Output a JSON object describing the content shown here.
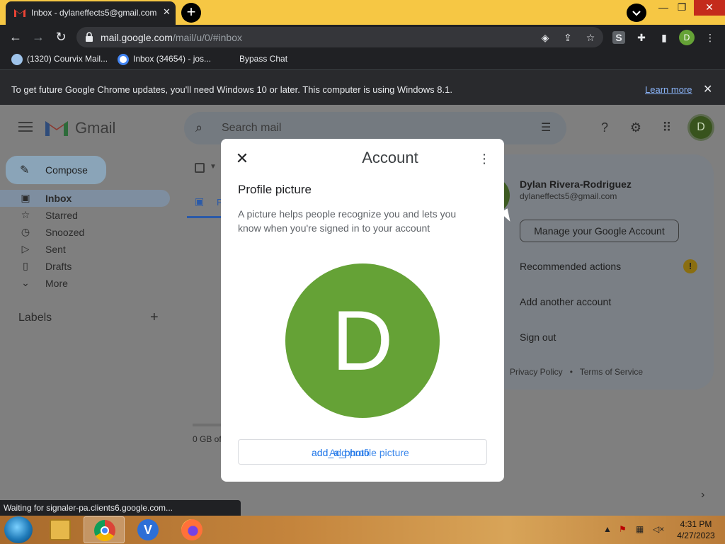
{
  "browser": {
    "tab_title": "Inbox - dylaneffects5@gmail.com",
    "new_tab": "+",
    "url_host": "mail.google.com",
    "url_path": "/mail/u/0/#inbox",
    "profile_letter": "D",
    "bookmarks": [
      {
        "label": "(1320) Courvix Mail..."
      },
      {
        "label": "Inbox (34654) - jos..."
      },
      {
        "label": "Bypass Chat"
      }
    ]
  },
  "infobar": {
    "message": "To get future Google Chrome updates, you'll need Windows 10 or later. This computer is using Windows 8.1.",
    "link": "Learn more"
  },
  "gmail": {
    "app_name": "Gmail",
    "search_placeholder": "Search mail",
    "avatar_letter": "D",
    "compose_label": "Compose",
    "nav": [
      {
        "label": "Inbox",
        "icon": "inbox-icon"
      },
      {
        "label": "Starred",
        "icon": "star-icon"
      },
      {
        "label": "Snoozed",
        "icon": "clock-icon"
      },
      {
        "label": "Sent",
        "icon": "send-icon"
      },
      {
        "label": "Drafts",
        "icon": "draft-icon"
      },
      {
        "label": "More",
        "icon": "chevron-down-icon"
      }
    ],
    "labels_title": "Labels",
    "list_tab_partial": "P",
    "storage_text": "0 GB of"
  },
  "account_popup": {
    "name": "Dylan Rivera-Rodriguez",
    "email": "dylaneffects5@gmail.com",
    "manage_button": "Manage your Google Account",
    "recommended": "Recommended actions",
    "warning_glyph": "!",
    "add_account": "Add another account",
    "sign_out": "Sign out",
    "privacy": "Privacy Policy",
    "separator": "•",
    "terms": "Terms of Service"
  },
  "modal": {
    "title": "Account",
    "section": "Profile picture",
    "description": "A picture helps people recognize you and lets you know when you're signed in to your account",
    "avatar_letter": "D",
    "button_label_overlay_1": "add_a_photo",
    "button_label_overlay_2": "Add profile picture"
  },
  "status_bubble": "Waiting for signaler-pa.clients6.google.com...",
  "taskbar": {
    "time": "4:31 PM",
    "date": "4/27/2023",
    "vpn_letter": "V"
  },
  "colors": {
    "avatar_green": "#65a236",
    "chrome_tab_bar": "#f6c744",
    "chrome_dark": "#202124",
    "link_blue": "#1a73e8"
  }
}
